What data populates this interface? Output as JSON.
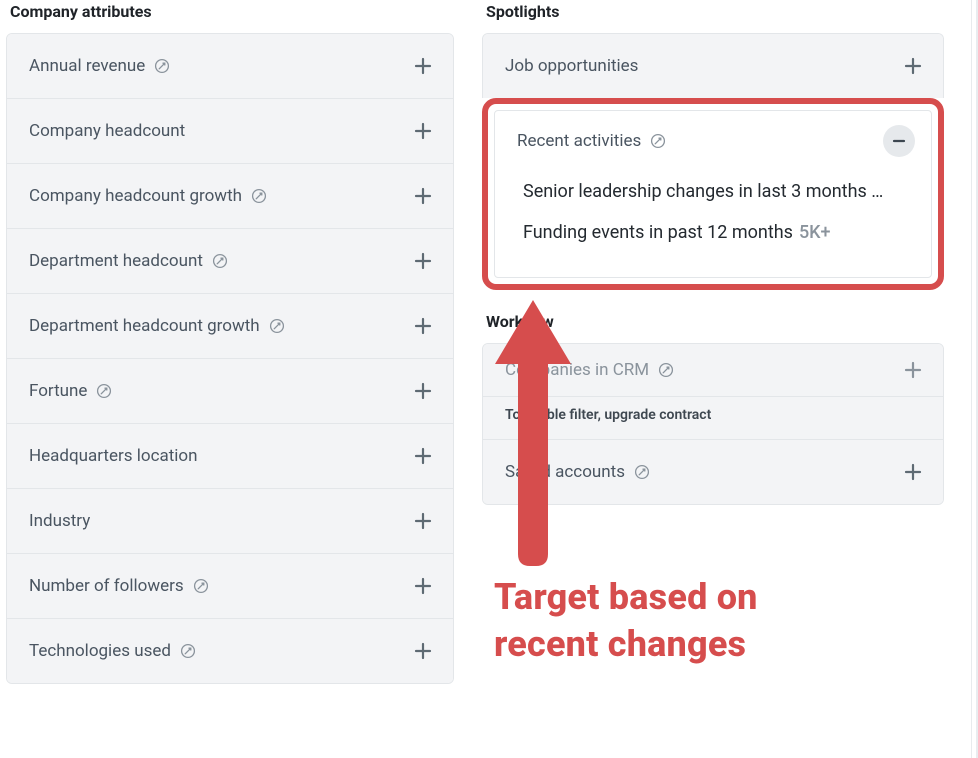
{
  "left": {
    "heading": "Company attributes",
    "items": [
      {
        "label": "Annual revenue",
        "has_info": true
      },
      {
        "label": "Company headcount",
        "has_info": false
      },
      {
        "label": "Company headcount growth",
        "has_info": true
      },
      {
        "label": "Department headcount",
        "has_info": true
      },
      {
        "label": "Department headcount growth",
        "has_info": true
      },
      {
        "label": "Fortune",
        "has_info": true
      },
      {
        "label": "Headquarters location",
        "has_info": false
      },
      {
        "label": "Industry",
        "has_info": false
      },
      {
        "label": "Number of followers",
        "has_info": true
      },
      {
        "label": "Technologies used",
        "has_info": true
      }
    ]
  },
  "right": {
    "spotlights": {
      "heading": "Spotlights",
      "top": [
        {
          "label": "Job opportunities"
        }
      ],
      "expanded": {
        "label": "Recent activities",
        "has_info": true,
        "options": [
          {
            "label": "Senior leadership changes in last 3 months …"
          },
          {
            "label": "Funding events in past 12 months",
            "count": "5K+"
          }
        ]
      }
    },
    "workflow": {
      "heading": "Workflow",
      "items": [
        {
          "label": "Companies in CRM",
          "has_info": true,
          "disabled": true,
          "note": "To enable filter, upgrade contract"
        },
        {
          "label": "Saved accounts",
          "has_info": true
        }
      ]
    }
  },
  "annotation": {
    "line1": "Target based on",
    "line2": "recent changes",
    "color": "#d64d4d"
  }
}
